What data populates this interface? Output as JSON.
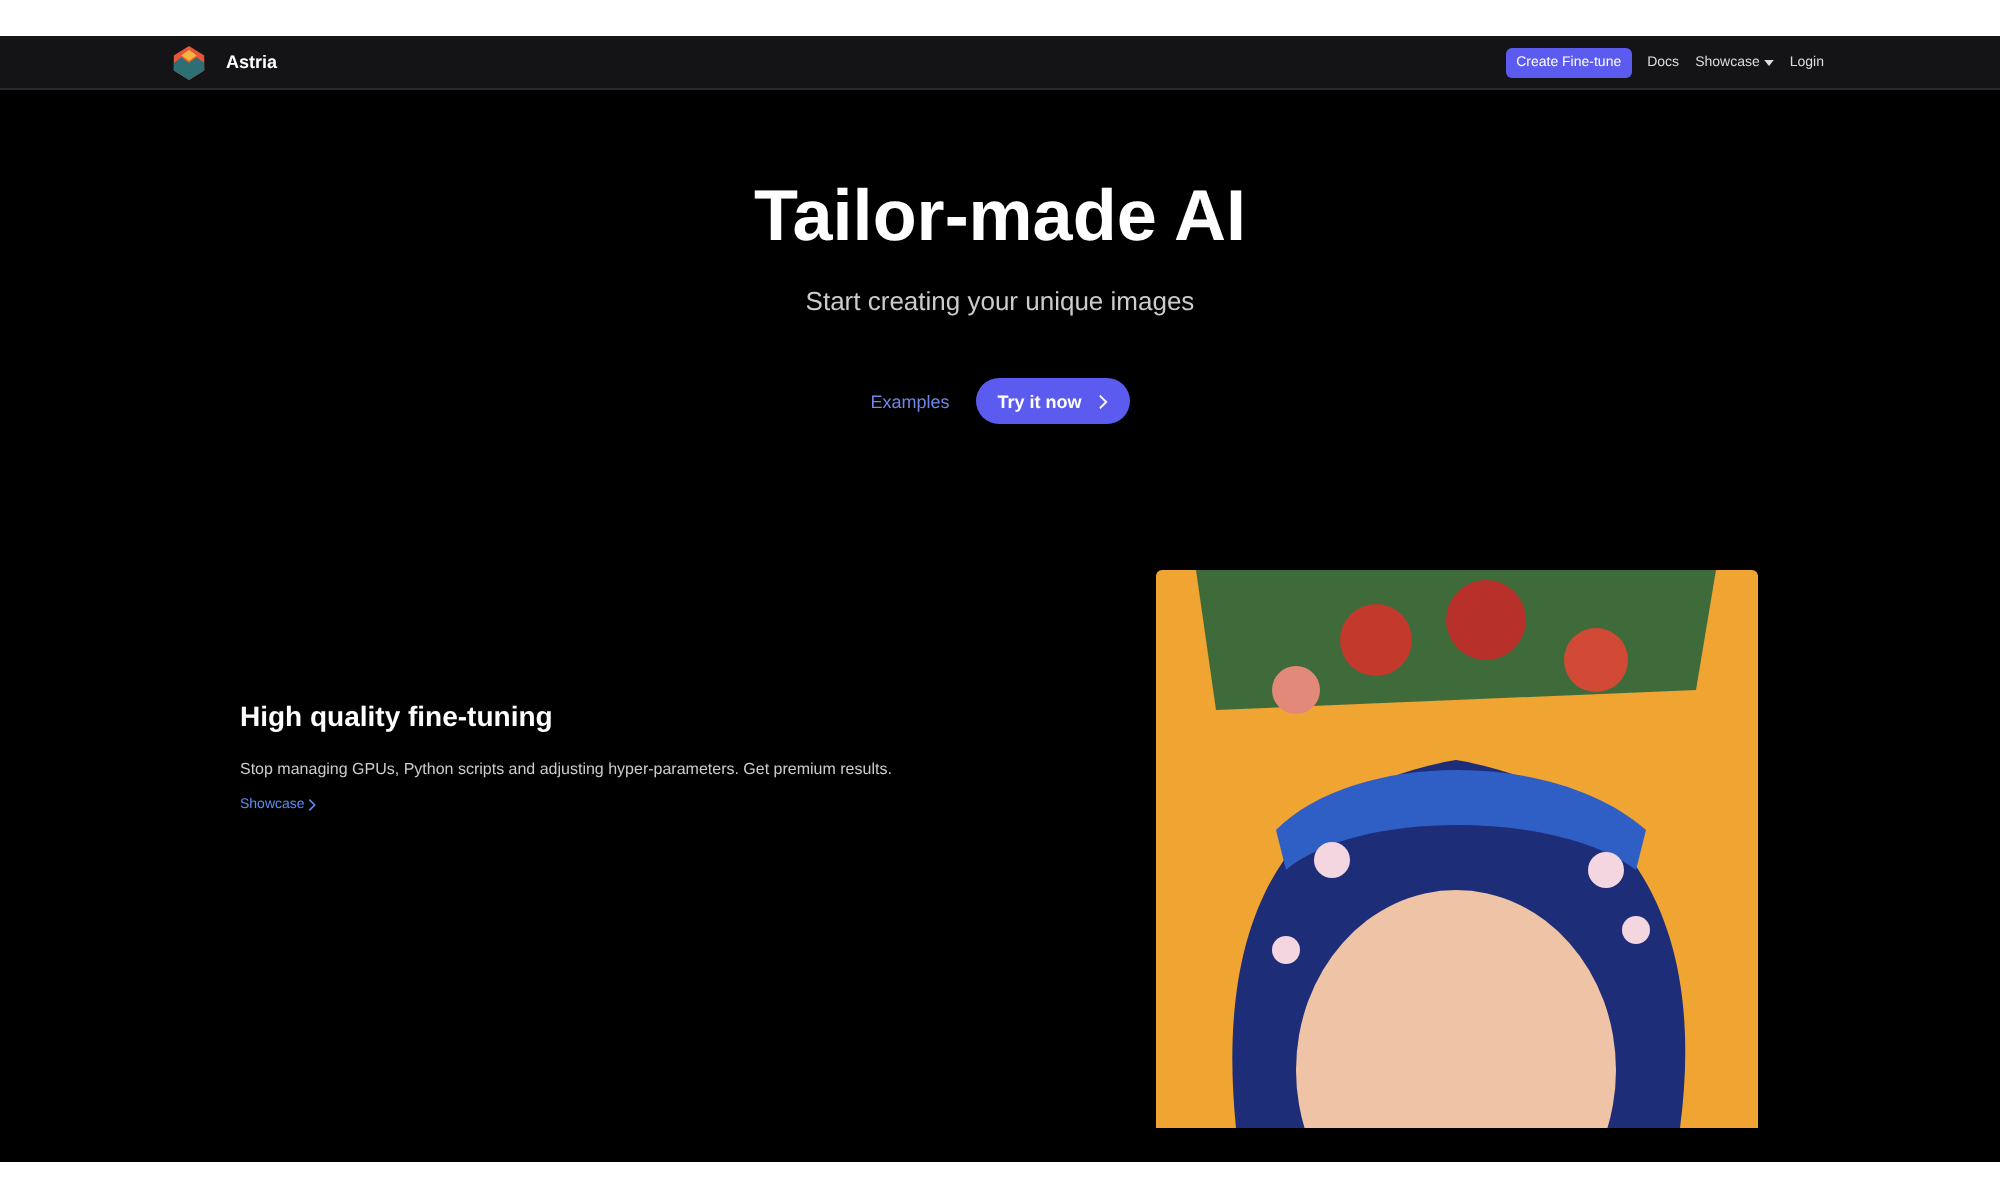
{
  "nav": {
    "brand": "Astria",
    "cta": "Create Fine-tune",
    "links": [
      {
        "label": "Docs",
        "dropdown": false
      },
      {
        "label": "Showcase",
        "dropdown": true
      },
      {
        "label": "Login",
        "dropdown": false
      }
    ]
  },
  "hero": {
    "title": "Tailor-made AI",
    "subtitle": "Start creating your unique images",
    "link": "Examples",
    "button": "Try it now"
  },
  "feature": {
    "title": "High quality fine-tuning",
    "text": "Stop managing GPUs, Python scripts and adjusting hyper-parameters. Get premium results.",
    "link": "Showcase"
  }
}
